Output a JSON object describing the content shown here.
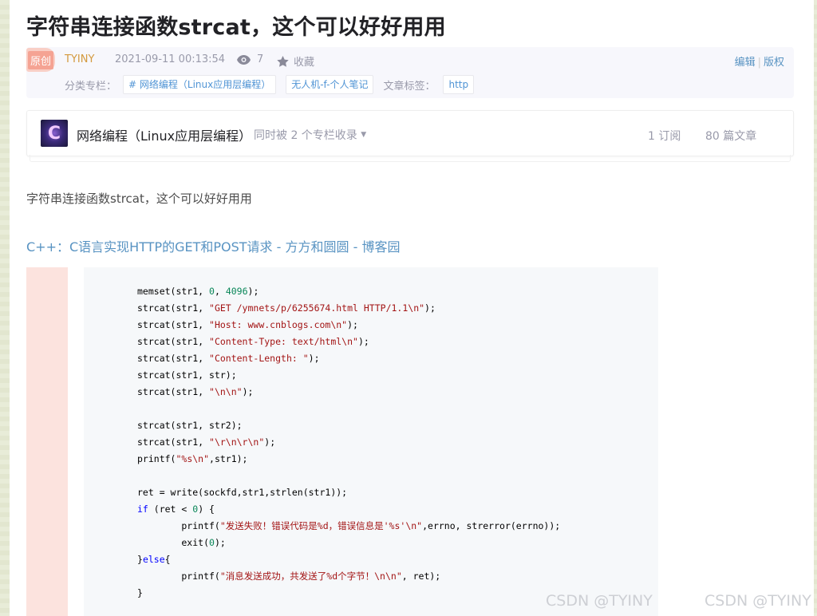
{
  "article": {
    "title": "字符串连接函数strcat，这个可以好好用用",
    "badge": "原创",
    "author": "TYINY",
    "datetime": "2021-09-11 00:13:54",
    "views": "7",
    "favorite_label": "收藏",
    "edit_label": "编辑",
    "copyright_label": "版权",
    "category_label": "分类专栏：",
    "categories": [
      "# 网络编程（Linux应用层编程）",
      "无人机-f-个人笔记"
    ],
    "tags_label": "文章标签：",
    "tags": [
      "http"
    ]
  },
  "column": {
    "thumb_letter": "C",
    "name": "网络编程（Linux应用层编程）",
    "multi_label": "同时被 2 个专栏收录",
    "subscriptions": "1 订阅",
    "articles": "80 篇文章"
  },
  "body": {
    "intro": "字符串连接函数strcat，这个可以好好用用",
    "link_text": "C++：C语言实现HTTP的GET和POST请求 - 方方和圆圆 - 博客园"
  },
  "code": {
    "lines": [
      "memset(str1, 0, 4096);",
      "strcat(str1, \"GET /ymnets/p/6255674.html HTTP/1.1\\n\");",
      "strcat(str1, \"Host: www.cnblogs.com\\n\");",
      "strcat(str1, \"Content-Type: text/html\\n\");",
      "strcat(str1, \"Content-Length: \");",
      "strcat(str1, str);",
      "strcat(str1, \"\\n\\n\");",
      "",
      "strcat(str1, str2);",
      "strcat(str1, \"\\r\\n\\r\\n\");",
      "printf(\"%s\\n\",str1);",
      "",
      "ret = write(sockfd,str1,strlen(str1));",
      "if (ret < 0) {",
      "        printf(\"发送失败！错误代码是%d，错误信息是'%s'\\n\",errno, strerror(errno));",
      "        exit(0);",
      "}else{",
      "        printf(\"消息发送成功，共发送了%d个字节！\\n\\n\", ret);",
      "}"
    ]
  },
  "watermarks": [
    "CSDN @TYINY",
    "CSDN @TYINY"
  ],
  "colors": {
    "link": "#5893c2",
    "author": "#d49a3f",
    "string": "#a31515",
    "keyword": "#0000ff",
    "number": "#098658"
  }
}
